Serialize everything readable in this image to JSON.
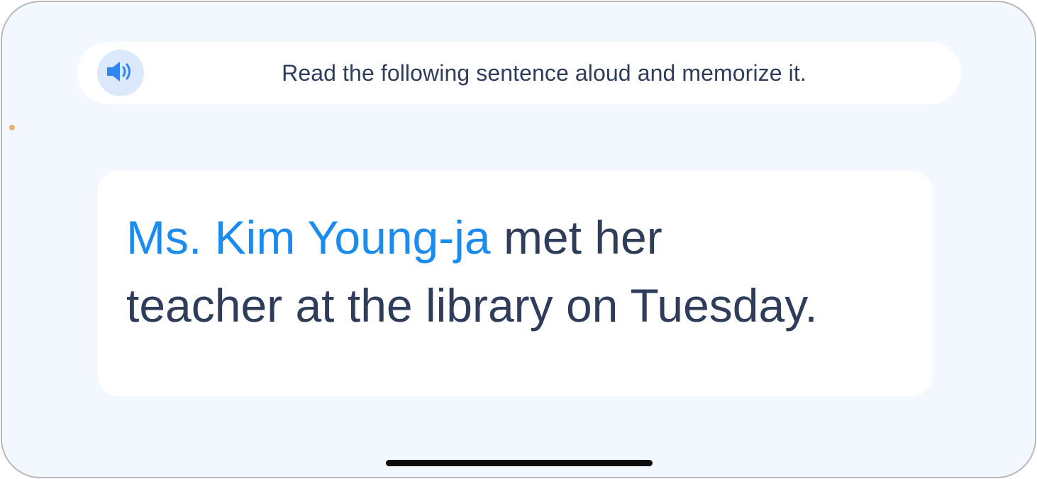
{
  "instruction": {
    "speaker_icon": "speaker-volume-icon",
    "text": "Read the following sentence aloud and memorize it."
  },
  "sentence": {
    "highlight": "Ms. Kim Young-ja",
    "rest_line1": " met her",
    "rest_line2": "teacher at the library on Tuesday."
  },
  "colors": {
    "background": "#f3f7fe",
    "text": "#2f3d5a",
    "highlight": "#1a8cf0",
    "speaker_bg": "#dce9fd",
    "speaker_icon": "#2f86f2"
  }
}
